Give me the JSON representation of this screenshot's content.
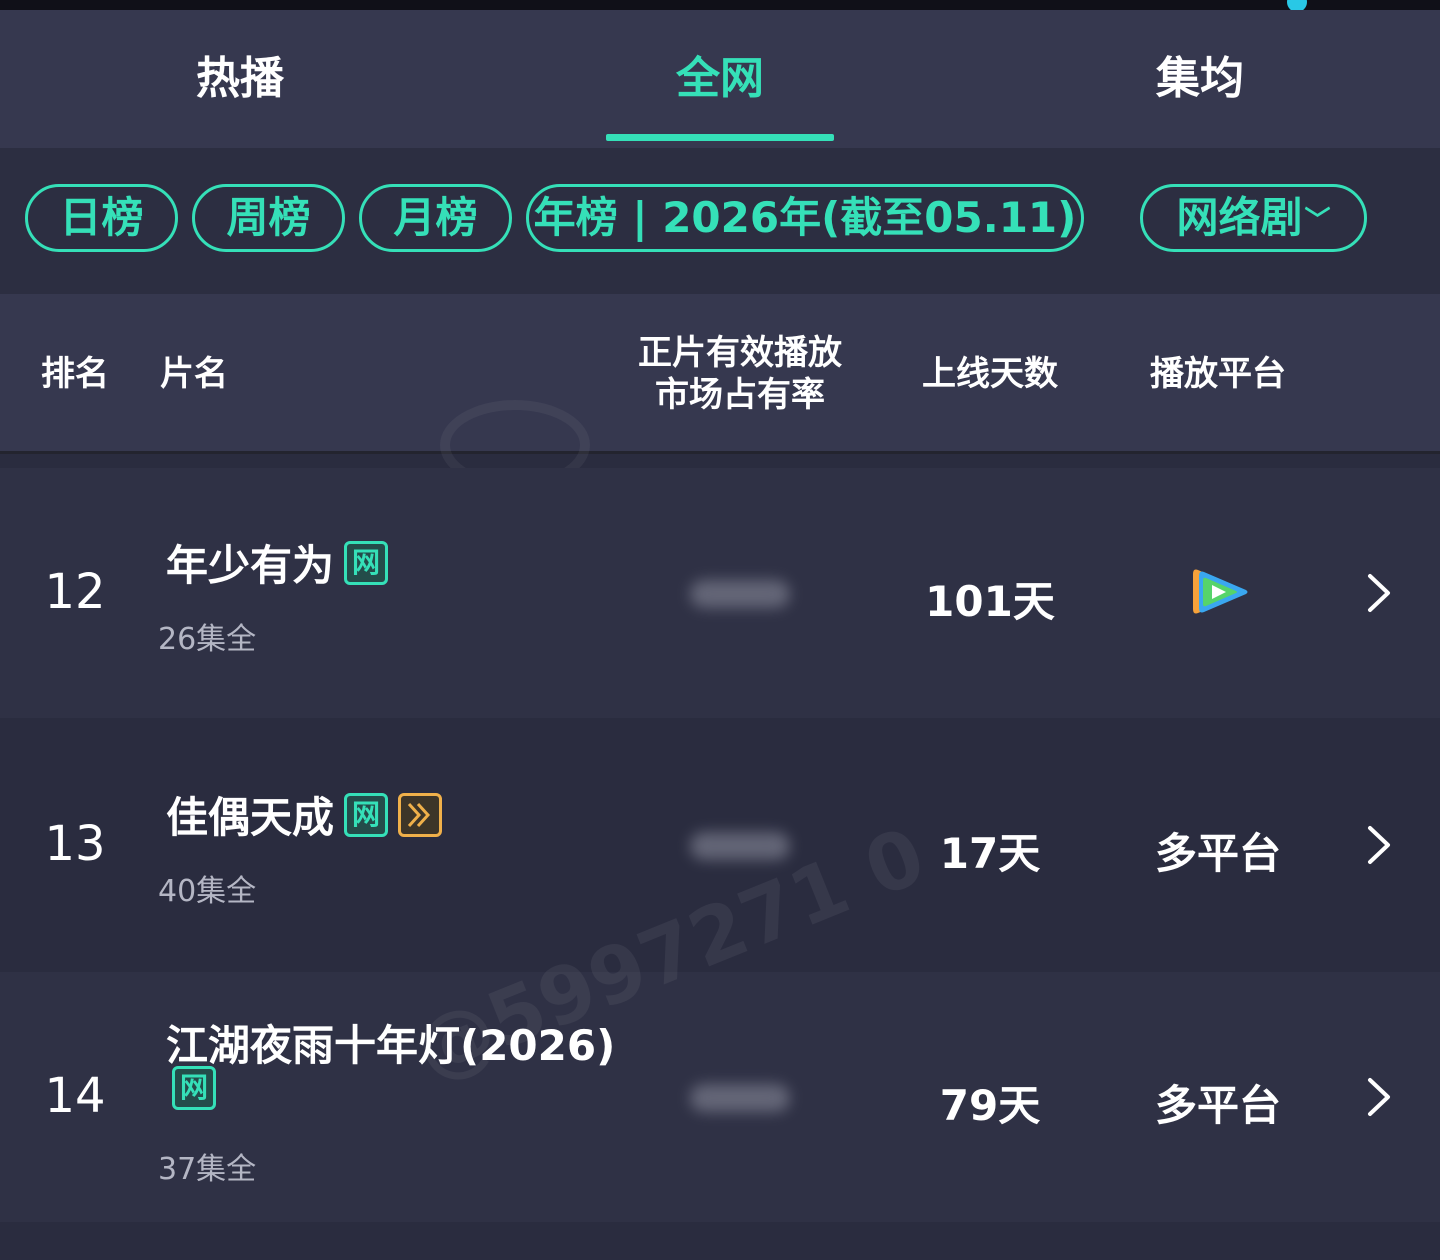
{
  "tabs": [
    {
      "label": "热播"
    },
    {
      "label": "全网"
    },
    {
      "label": "集均"
    }
  ],
  "filters": {
    "day": "日榜",
    "week": "周榜",
    "month": "月榜",
    "year": "年榜 | 2026年(截至05.11)",
    "category": "网络剧"
  },
  "header": {
    "rank": "排名",
    "title": "片名",
    "share_line1": "正片有效播放",
    "share_line2": "市场占有率",
    "days": "上线天数",
    "platform": "播放平台"
  },
  "rows": [
    {
      "rank": "12",
      "title": "年少有为",
      "badge_net": "网",
      "episodes": "26集全",
      "days": "101天",
      "platform_icon": "tencent-video-icon"
    },
    {
      "rank": "13",
      "title": "佳偶天成",
      "badge_net": "网",
      "badge_other_icon": "double-chevron-icon",
      "episodes": "40集全",
      "days": "17天",
      "platform": "多平台"
    },
    {
      "rank": "14",
      "title": "江湖夜雨十年灯(2026)",
      "badge_net": "网",
      "episodes": "37集全",
      "days": "79天",
      "platform": "多平台"
    }
  ],
  "watermark": "@5997271 0",
  "colors": {
    "accent": "#35e0b8",
    "background": "#2a2c3f",
    "panel": "#36384f",
    "badge_orange": "#f0b04a"
  }
}
